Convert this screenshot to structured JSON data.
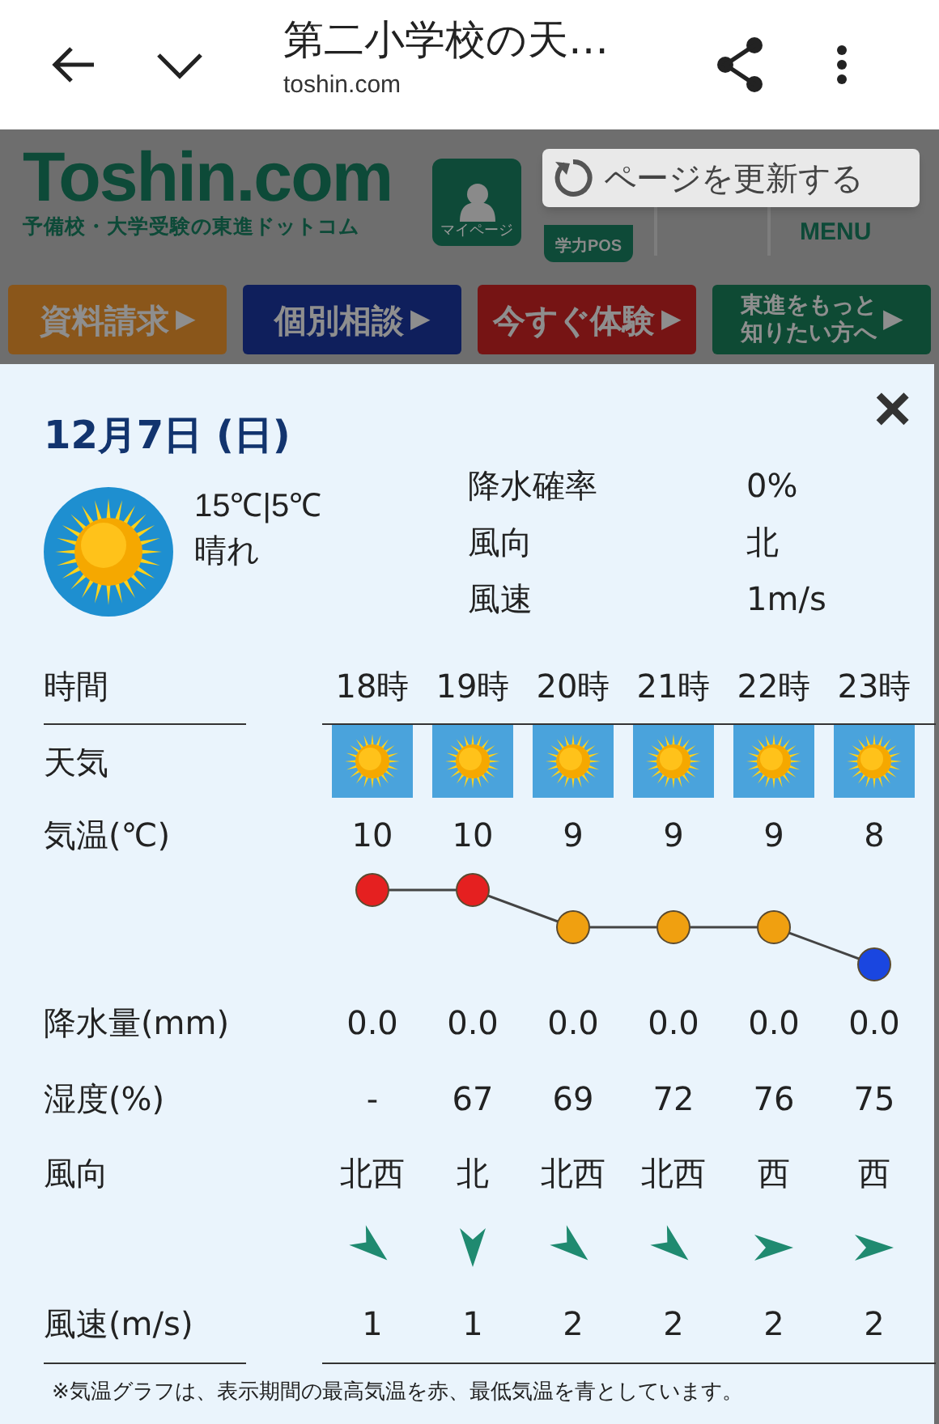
{
  "browser_bar": {
    "title": "第二小学校の天…",
    "domain": "toshin.com"
  },
  "site_header": {
    "logo": "Toshin.com",
    "tagline": "予備校・大学受験の東進ドットコム",
    "mypage": "マイページ",
    "score": "学力POS",
    "menu": "MENU",
    "buttons": [
      {
        "lines": [
          "資料請求"
        ],
        "arrow": "▶",
        "color": "#8a561a"
      },
      {
        "lines": [
          "個別相談"
        ],
        "arrow": "▶",
        "color": "#0f1f5c"
      },
      {
        "lines": [
          "今すぐ体験"
        ],
        "arrow": "▶",
        "color": "#761414"
      },
      {
        "lines": [
          "東進をもっと",
          "知りたい方へ"
        ],
        "arrow": "▶",
        "color": "#0e4a34"
      }
    ]
  },
  "refresh_button": {
    "label": "ページを更新する"
  },
  "forecast": {
    "close": "×",
    "date": "12月7日 (日)",
    "temperature": "15℃|5℃",
    "condition": "晴れ",
    "kind": "sunny",
    "details": [
      {
        "label": "降水確率",
        "value": "0%"
      },
      {
        "label": "風向",
        "value": "北"
      },
      {
        "label": "風速",
        "value": "1m/s"
      }
    ],
    "labels": {
      "time": "時間",
      "weather": "天気",
      "temperature": "気温(℃)",
      "precipitation": "降水量(mm)",
      "humidity": "湿度(%)",
      "wind_direction": "風向",
      "wind_speed": "風速(m/s)"
    },
    "hours": [
      {
        "time": "18時",
        "kind": "sunny",
        "temperature": "10",
        "color": "#e52020",
        "precipitation": "0.0",
        "humidity": "-",
        "wind_direction": "北西",
        "wind_arrow": {
          "kind": "southeast"
        },
        "wind_speed": "1"
      },
      {
        "time": "19時",
        "kind": "sunny",
        "temperature": "10",
        "color": "#e52020",
        "precipitation": "0.0",
        "humidity": "67",
        "wind_direction": "北",
        "wind_arrow": {
          "kind": "south"
        },
        "wind_speed": "1"
      },
      {
        "time": "20時",
        "kind": "sunny",
        "temperature": "9",
        "color": "#f0a010",
        "precipitation": "0.0",
        "humidity": "69",
        "wind_direction": "北西",
        "wind_arrow": {
          "kind": "southeast"
        },
        "wind_speed": "2"
      },
      {
        "time": "21時",
        "kind": "sunny",
        "temperature": "9",
        "color": "#f0a010",
        "precipitation": "0.0",
        "humidity": "72",
        "wind_direction": "北西",
        "wind_arrow": {
          "kind": "southeast"
        },
        "wind_speed": "2"
      },
      {
        "time": "22時",
        "kind": "sunny",
        "temperature": "9",
        "color": "#f0a010",
        "precipitation": "0.0",
        "humidity": "76",
        "wind_direction": "西",
        "wind_arrow": {
          "kind": "east"
        },
        "wind_speed": "2"
      },
      {
        "time": "23時",
        "kind": "sunny",
        "temperature": "8",
        "color": "#1a46e0",
        "precipitation": "0.0",
        "humidity": "75",
        "wind_direction": "西",
        "wind_arrow": {
          "kind": "east"
        },
        "wind_speed": "2"
      }
    ],
    "footnote": "※気温グラフは、表示期間の最高気温を赤、最低気温を青としています。"
  }
}
